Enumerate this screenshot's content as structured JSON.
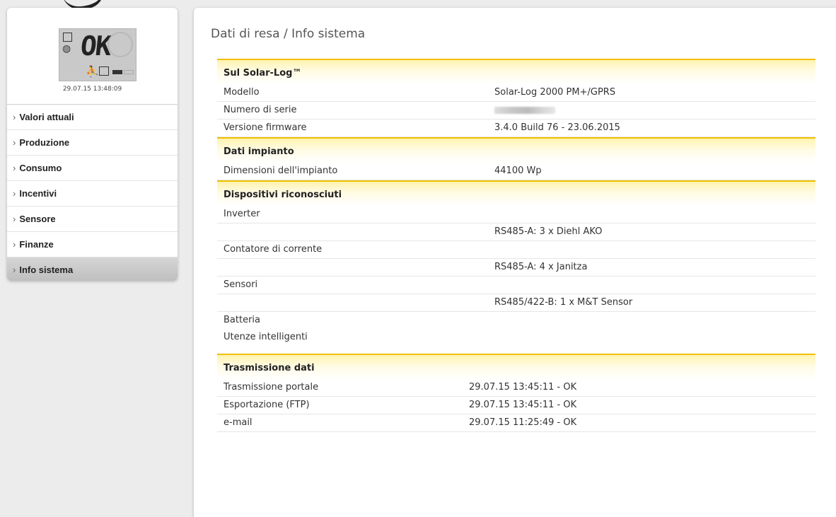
{
  "sidebar": {
    "lcd": {
      "status": "OK",
      "timestamp": "29.07.15 13:48:09"
    },
    "items": [
      {
        "label": "Valori attuali"
      },
      {
        "label": "Produzione"
      },
      {
        "label": "Consumo"
      },
      {
        "label": "Incentivi"
      },
      {
        "label": "Sensore"
      },
      {
        "label": "Finanze"
      },
      {
        "label": "Info sistema",
        "active": true
      }
    ]
  },
  "main": {
    "title": "Dati di resa / Info sistema",
    "sections": {
      "solarlog": {
        "header": "Sul Solar-Log™",
        "rows": [
          {
            "label": "Modello",
            "value": "Solar-Log 2000 PM+/GPRS"
          },
          {
            "label": "Numero di serie",
            "value": ""
          },
          {
            "label": "Versione firmware",
            "value": "3.4.0 Build 76 - 23.06.2015"
          }
        ]
      },
      "impianto": {
        "header": "Dati impianto",
        "rows": [
          {
            "label": "Dimensioni dell'impianto",
            "value": "44100 Wp"
          }
        ]
      },
      "dispositivi": {
        "header": "Dispositivi riconosciuti",
        "rows": [
          {
            "label": "Inverter",
            "value": ""
          },
          {
            "label": "",
            "value": "RS485-A: 3 x Diehl AKO"
          },
          {
            "label": "Contatore di corrente",
            "value": ""
          },
          {
            "label": "",
            "value": "RS485-A: 4 x Janitza"
          },
          {
            "label": "Sensori",
            "value": ""
          },
          {
            "label": "",
            "value": "RS485/422-B: 1 x M&T Sensor"
          },
          {
            "label": "Batteria",
            "value": ""
          },
          {
            "label": "Utenze intelligenti",
            "value": ""
          }
        ]
      },
      "trasmissione": {
        "header": "Trasmissione dati",
        "rows": [
          {
            "label": "Trasmissione portale",
            "value": "29.07.15 13:45:11 - OK"
          },
          {
            "label": "Esportazione (FTP)",
            "value": "29.07.15 13:45:11 - OK"
          },
          {
            "label": "e-mail",
            "value": "29.07.15 11:25:49 - OK"
          }
        ]
      }
    }
  },
  "colors": {
    "section_accent": "#f0c000",
    "active_nav": "#c8c8c8"
  }
}
